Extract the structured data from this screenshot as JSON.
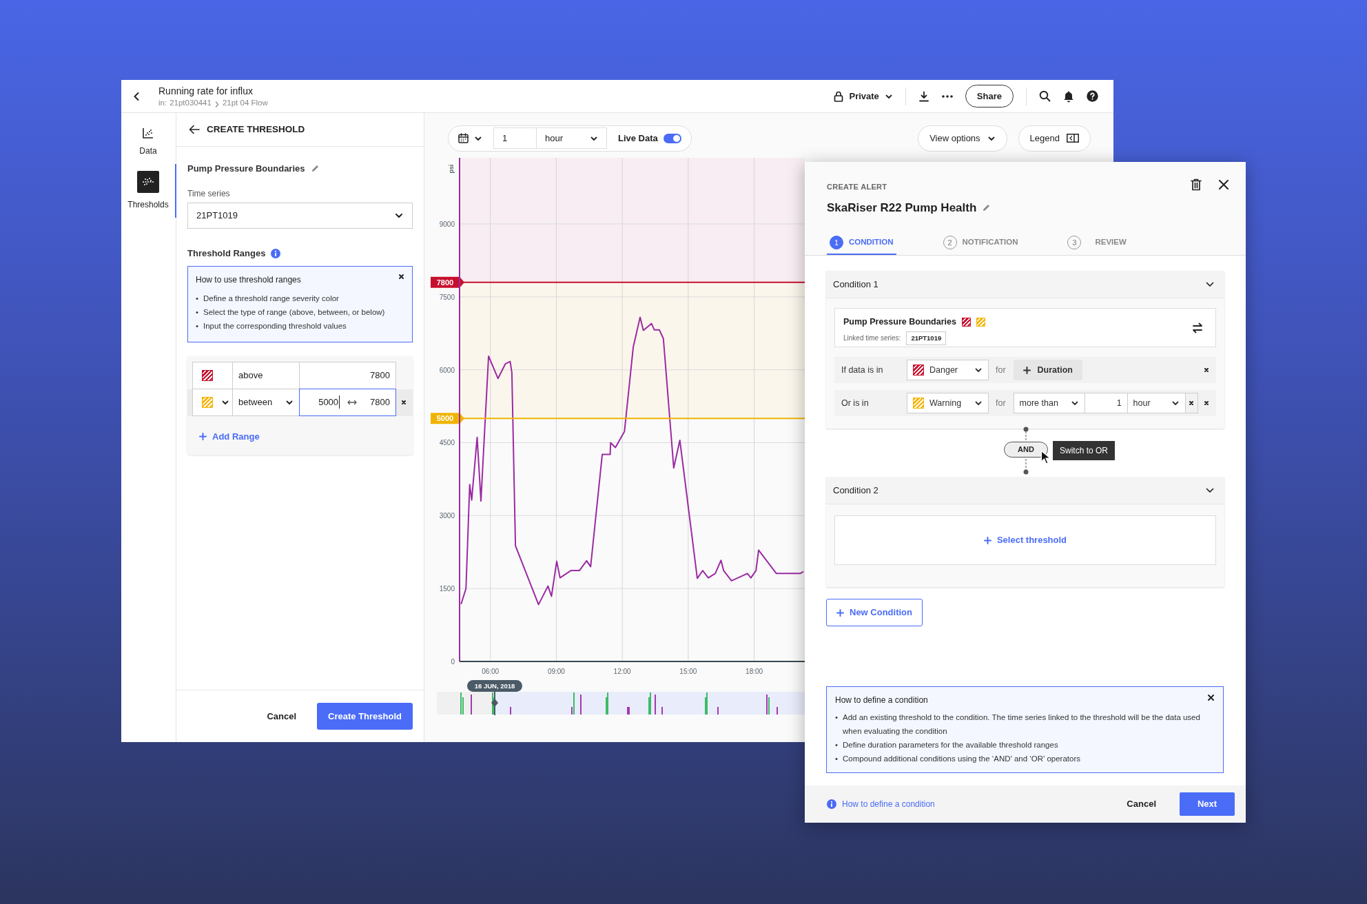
{
  "app_bar": {
    "title": "Running rate for influx",
    "breadcrumb_prefix": "in:",
    "breadcrumb": [
      "21pt030441",
      "21pt 04 Flow"
    ],
    "privacy": "Private",
    "share": "Share"
  },
  "rail": [
    {
      "label": "Data",
      "selected": false
    },
    {
      "label": "Thresholds",
      "selected": true
    }
  ],
  "threshold_panel": {
    "header": "CREATE THRESHOLD",
    "name": "Pump Pressure Boundaries",
    "time_series_label": "Time series",
    "time_series": "21PT1019",
    "ranges_title": "Threshold Ranges",
    "help": {
      "title": "How to use threshold ranges",
      "marker": "•",
      "bullets": [
        "Define a threshold range severity color",
        "Select the type of range (above, between, or below)",
        "Input the corresponding threshold values"
      ]
    },
    "ranges": [
      {
        "color": "#c8102e",
        "type": "above",
        "values": [
          "7800"
        ],
        "active": false
      },
      {
        "color": "#f5b400",
        "type": "between",
        "values": [
          "5000",
          "7800"
        ],
        "active": true
      }
    ],
    "add_range": "Add Range",
    "cancel": "Cancel",
    "submit": "Create Threshold"
  },
  "chart_toolbar": {
    "count": "1",
    "unit": "hour",
    "live_label": "Live Data",
    "live_on": true,
    "view_options": "View options",
    "legend": "Legend"
  },
  "chart": {
    "chart_data": {
      "type": "line",
      "ylabel": "psi",
      "x": [
        4.67,
        4.89,
        5.06,
        5.15,
        5.4,
        5.57,
        5.92,
        6.35,
        6.68,
        6.9,
        6.98,
        7.14,
        8.19,
        8.62,
        8.78,
        9.02,
        9.17,
        9.66,
        10.05,
        10.38,
        10.56,
        11.09,
        11.45,
        11.47,
        11.69,
        12.1,
        12.5,
        12.81,
        12.96,
        13.33,
        13.46,
        13.69,
        13.87,
        14.34,
        14.62,
        15.41,
        15.66,
        15.91,
        16.23,
        16.49,
        16.61,
        16.97,
        17.69,
        17.85,
        18.08,
        18.2,
        19.01,
        20.09,
        20.24
      ],
      "series": [
        {
          "color": "#9b2aa3",
          "values": [
            1180,
            1500,
            3640,
            3320,
            4610,
            3300,
            6280,
            5820,
            6120,
            6170,
            5940,
            2380,
            1170,
            1550,
            1340,
            2060,
            1720,
            1870,
            1870,
            2070,
            1950,
            4260,
            4260,
            4500,
            4400,
            4730,
            6470,
            7080,
            6810,
            6950,
            6820,
            6820,
            6640,
            3980,
            4550,
            1710,
            1870,
            1720,
            1810,
            2080,
            1870,
            1660,
            1810,
            1720,
            1870,
            2290,
            1810,
            1810,
            1850
          ]
        }
      ],
      "xlim": [
        4.6,
        20.3
      ],
      "ylim": [
        0,
        10360
      ],
      "grid": true,
      "xticks": [
        {
          "value": 6,
          "label": "06:00"
        },
        {
          "value": 9,
          "label": "09:00"
        },
        {
          "value": 12,
          "label": "12:00"
        },
        {
          "value": 15,
          "label": "15:00"
        },
        {
          "value": 18,
          "label": "18:00"
        }
      ],
      "yticks": [
        0,
        1500,
        3000,
        4500,
        6000,
        7500,
        9000
      ],
      "bands": [
        {
          "axis": "y",
          "from": 7800,
          "to": 10360,
          "color": "#f7edf2"
        },
        {
          "axis": "y",
          "from": 5000,
          "to": 7800,
          "color": "#fbf6ec"
        }
      ],
      "ref_lines": [
        {
          "axis": "y",
          "value": 7800,
          "label": "7800",
          "color": "#c8102e"
        },
        {
          "axis": "y",
          "value": 5000,
          "label": "5000",
          "color": "#f0b400"
        }
      ]
    },
    "timeline_label": "16 JUN, 2018"
  },
  "alert_modal": {
    "eyebrow": "CREATE ALERT",
    "title": "SkaRiser R22 Pump Health",
    "steps": [
      {
        "number": "1",
        "label": "CONDITION",
        "selected": true
      },
      {
        "number": "2",
        "label": "NOTIFICATION",
        "selected": false
      },
      {
        "number": "3",
        "label": "REVIEW",
        "selected": false
      }
    ],
    "conditions": [
      {
        "title": "Condition 1",
        "threshold": {
          "name": "Pump Pressure Boundaries",
          "swatches": [
            {
              "color": "#c8102e"
            },
            {
              "color": "#f5b400"
            }
          ],
          "linked_label": "Linked time series:",
          "linked": "21PT1019"
        },
        "rules": [
          {
            "kind": "button",
            "lead": "If data is in",
            "range": "Danger",
            "color": "#c8102e",
            "for": "for",
            "duration": "Duration"
          },
          {
            "kind": "set",
            "lead": "Or is in",
            "range": "Warning",
            "color": "#f5b400",
            "for": "for",
            "comparator": "more than",
            "amount": "1",
            "unit": "hour"
          }
        ]
      },
      {
        "title": "Condition 2",
        "select_threshold": "Select threshold"
      }
    ],
    "operator": "AND",
    "operator_tooltip": "Switch to OR",
    "new_condition": "New Condition",
    "help": {
      "title": "How to define a condition",
      "marker": "•",
      "bullets": [
        "Add an existing threshold to the condition. The time series linked to the threshold will be the data used when evaluating the condition",
        "Define duration parameters for the available threshold ranges",
        "Compound additional conditions using the ‘AND’ and ‘OR’ operators"
      ]
    },
    "footer_link": "How to define a condition",
    "cancel": "Cancel",
    "next": "Next"
  }
}
